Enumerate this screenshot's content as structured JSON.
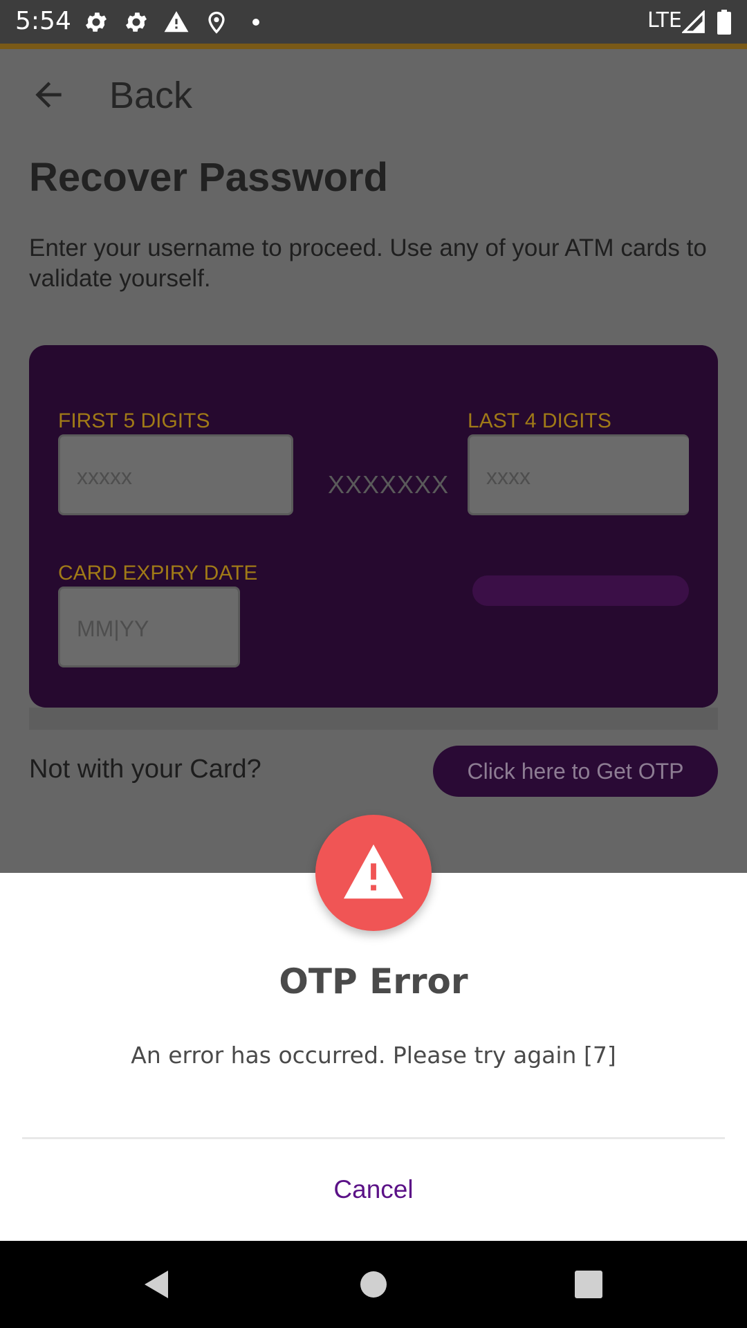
{
  "status_bar": {
    "time": "5:54",
    "network": "LTE",
    "icons": [
      "gear-icon",
      "gear-icon",
      "warning-icon",
      "location-icon",
      "dot-icon",
      "signal-icon",
      "battery-icon"
    ]
  },
  "header": {
    "back_label": "Back"
  },
  "page": {
    "title": "Recover Password",
    "subtitle": "Enter your username to proceed. Use any of your ATM cards to validate yourself."
  },
  "card": {
    "first_digits_label": "FIRST 5 DIGITS",
    "first_digits_placeholder": "xxxxx",
    "masked_middle": "XXXXXXX",
    "last_digits_label": "LAST 4 DIGITS",
    "last_digits_placeholder": "xxxx",
    "expiry_label": "CARD EXPIRY DATE",
    "expiry_placeholder": "MM|YY"
  },
  "otp_row": {
    "prompt": "Not with your Card?",
    "button_label": "Click here to Get OTP"
  },
  "dialog": {
    "icon": "warning-icon",
    "title": "OTP Error",
    "message": "An error has occurred. Please try again [7]",
    "cancel_label": "Cancel"
  },
  "colors": {
    "accent_purple": "#5b1287",
    "alert_red": "#f05555",
    "card_bg": "#26092f",
    "label_gold": "#a07a17"
  }
}
